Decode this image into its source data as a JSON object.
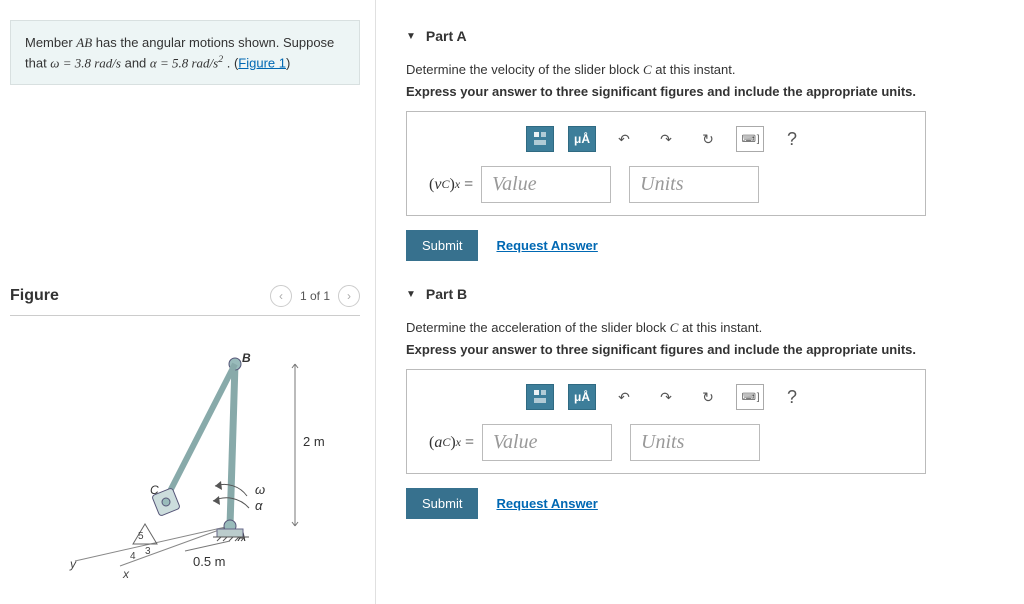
{
  "problem": {
    "pre": "Member ",
    "var1": "AB",
    "mid1": " has the angular motions shown. Suppose that ",
    "omega_eq": "ω = 3.8 rad/s",
    "and": " and ",
    "alpha_eq": "α = 5.8 rad/s",
    "alpha_exp": "2",
    "post": " . (",
    "link_text": "Figure 1",
    "close": ")"
  },
  "figure": {
    "title": "Figure",
    "nav": "1 of 1",
    "labels": {
      "B": "B",
      "C": "C",
      "A": "A",
      "dim2m": "2 m",
      "dim05m": "0.5 m",
      "omega": "ω",
      "alpha": "α",
      "five": "5",
      "three": "3",
      "four": "4",
      "x": "x",
      "y": "y"
    }
  },
  "parts": {
    "a": {
      "title": "Part A",
      "prompt_pre": "Determine the velocity of the slider block ",
      "prompt_var": "C",
      "prompt_post": " at this instant.",
      "instr": "Express your answer to three significant figures and include the appropriate units.",
      "lhs_html": "(v<sub style='font-style:italic'>C</sub>)<sub style='font-style:italic'>x</sub> =",
      "value_ph": "Value",
      "units_ph": "Units"
    },
    "b": {
      "title": "Part B",
      "prompt_pre": "Determine the acceleration of the slider block ",
      "prompt_var": "C",
      "prompt_post": " at this instant.",
      "instr": "Express your answer to three significant figures and include the appropriate units.",
      "lhs_html": "(a<sub style='font-style:italic'>C</sub>)<sub style='font-style:italic'>x</sub> =",
      "value_ph": "Value",
      "units_ph": "Units"
    }
  },
  "toolbar": {
    "micro": "μÅ",
    "undo": "↶",
    "redo": "↷",
    "reset": "↻",
    "kb": "⌨ ]",
    "help": "?"
  },
  "buttons": {
    "submit": "Submit",
    "request": "Request Answer"
  }
}
